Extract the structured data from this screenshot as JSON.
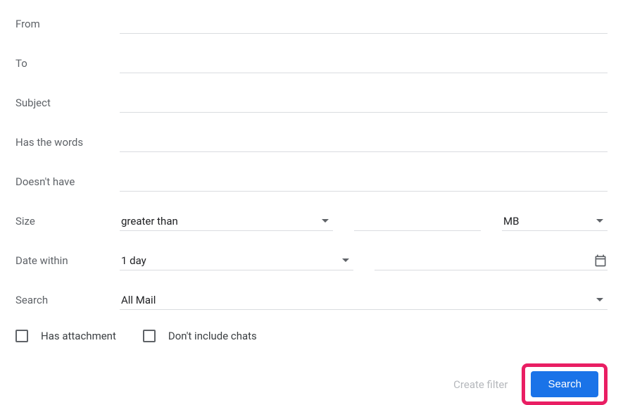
{
  "labels": {
    "from": "From",
    "to": "To",
    "subject": "Subject",
    "has_words": "Has the words",
    "doesnt_have": "Doesn't have",
    "size": "Size",
    "date_within": "Date within",
    "search": "Search"
  },
  "fields": {
    "from_value": "",
    "to_value": "",
    "subject_value": "",
    "has_words_value": "",
    "doesnt_have_value": "",
    "size_comparator": "greater than",
    "size_value": "",
    "size_unit": "MB",
    "date_range": "1 day",
    "date_value": "",
    "search_scope": "All Mail"
  },
  "checkboxes": {
    "has_attachment": "Has attachment",
    "dont_include_chats": "Don't include chats"
  },
  "footer": {
    "create_filter": "Create filter",
    "search_button": "Search"
  }
}
